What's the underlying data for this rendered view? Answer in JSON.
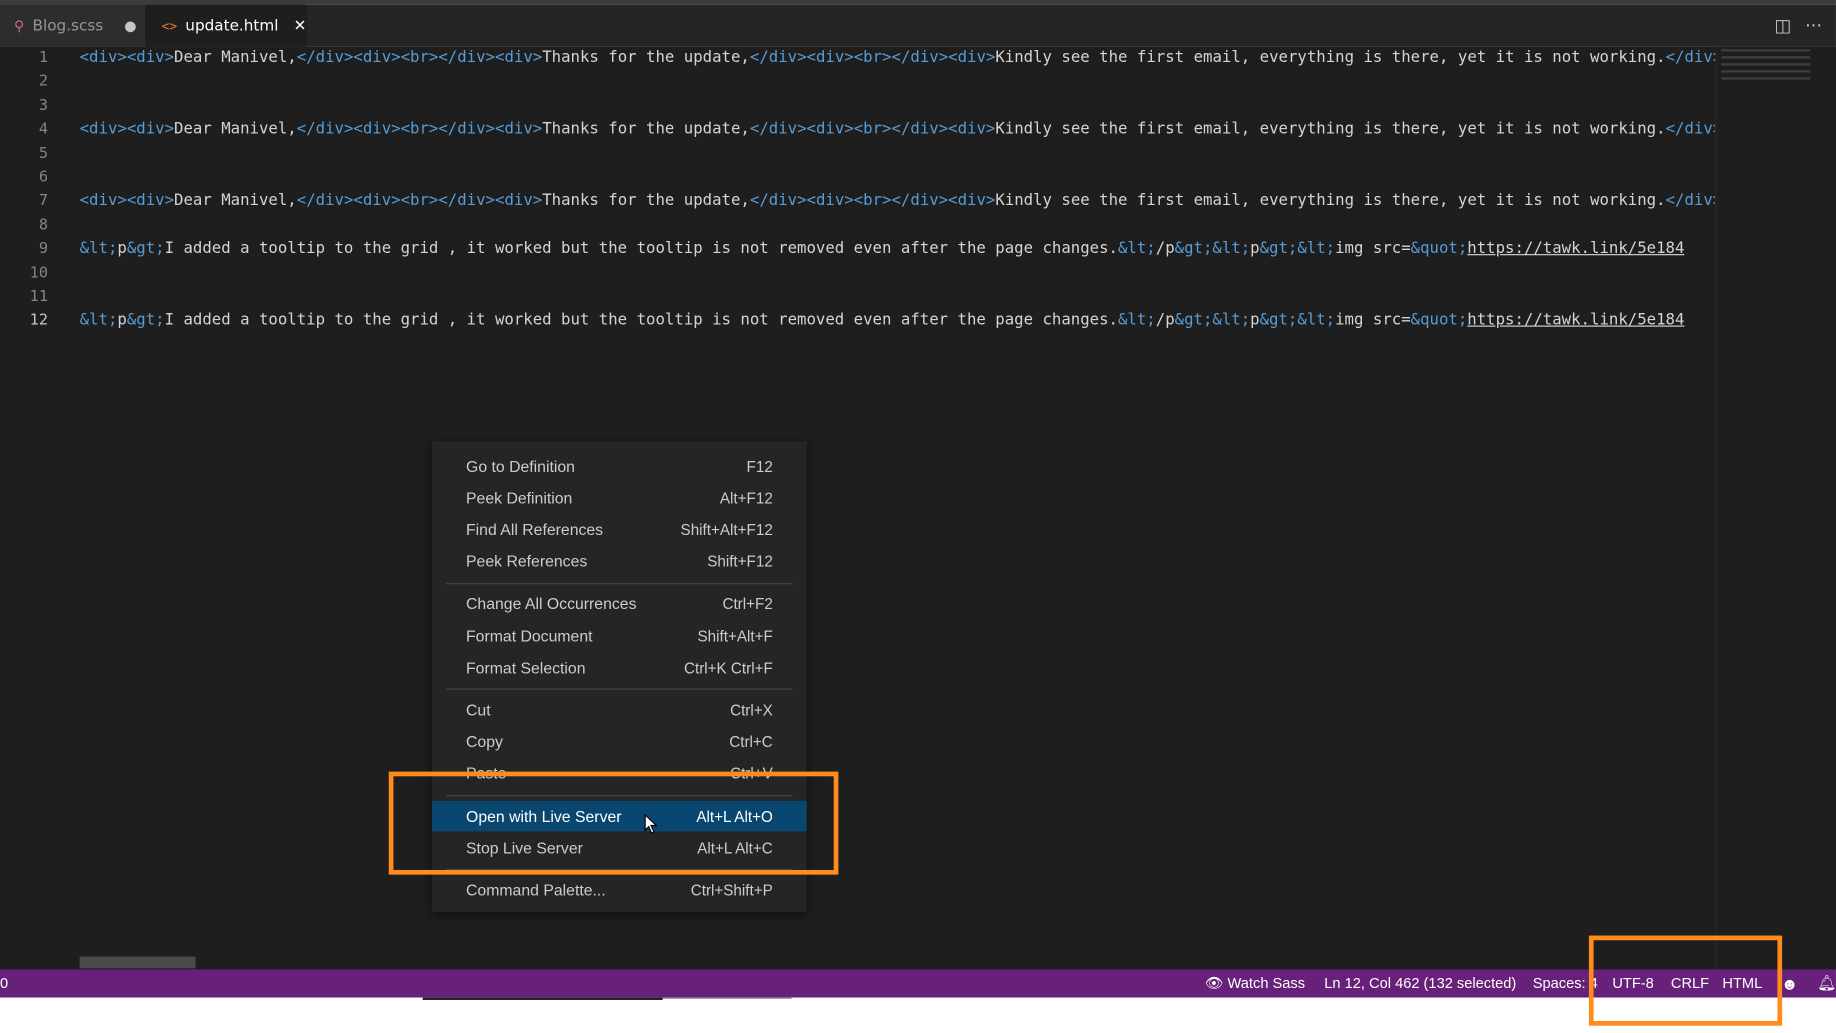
{
  "tabs": [
    {
      "label": "Blog.scss",
      "icon": "sass-file-icon",
      "dirty_symbol": "●"
    },
    {
      "label": "update.html",
      "icon": "html-file-icon",
      "close_symbol": "✕",
      "active": true
    }
  ],
  "tabbar_actions": [
    {
      "icon": "split-editor-icon",
      "glyph": "◫"
    },
    {
      "icon": "more-actions-icon",
      "glyph": "···"
    }
  ],
  "editor": {
    "line_numbers": [
      "1",
      "2",
      "3",
      "4",
      "5",
      "6",
      "7",
      "8",
      "9",
      "10",
      "11",
      "12"
    ],
    "active_line": 12,
    "lines": [
      [
        [
          "t",
          "<div>"
        ],
        [
          "t",
          "<div>"
        ],
        [
          "x",
          "Dear Manivel,"
        ],
        [
          "t",
          "</div>"
        ],
        [
          "t",
          "<div>"
        ],
        [
          "t",
          "<br>"
        ],
        [
          "t",
          "</div>"
        ],
        [
          "t",
          "<div>"
        ],
        [
          "x",
          "Thanks for the update,"
        ],
        [
          "t",
          "</div>"
        ],
        [
          "t",
          "<div>"
        ],
        [
          "t",
          "<br>"
        ],
        [
          "t",
          "</div>"
        ],
        [
          "t",
          "<div>"
        ],
        [
          "x",
          "Kindly see the first email, everything is there, yet it is not working."
        ],
        [
          "t",
          "</div>"
        ]
      ],
      [],
      [],
      [
        [
          "t",
          "<div>"
        ],
        [
          "t",
          "<div>"
        ],
        [
          "x",
          "Dear Manivel,"
        ],
        [
          "t",
          "</div>"
        ],
        [
          "t",
          "<div>"
        ],
        [
          "t",
          "<br>"
        ],
        [
          "t",
          "</div>"
        ],
        [
          "t",
          "<div>"
        ],
        [
          "x",
          "Thanks for the update,"
        ],
        [
          "t",
          "</div>"
        ],
        [
          "t",
          "<div>"
        ],
        [
          "t",
          "<br>"
        ],
        [
          "t",
          "</div>"
        ],
        [
          "t",
          "<div>"
        ],
        [
          "x",
          "Kindly see the first email, everything is there, yet it is not working."
        ],
        [
          "t",
          "</div>"
        ]
      ],
      [],
      [],
      [
        [
          "t",
          "<div>"
        ],
        [
          "t",
          "<div>"
        ],
        [
          "x",
          "Dear Manivel,"
        ],
        [
          "t",
          "</div>"
        ],
        [
          "t",
          "<div>"
        ],
        [
          "t",
          "<br>"
        ],
        [
          "t",
          "</div>"
        ],
        [
          "t",
          "<div>"
        ],
        [
          "x",
          "Thanks for the update,"
        ],
        [
          "t",
          "</div>"
        ],
        [
          "t",
          "<div>"
        ],
        [
          "t",
          "<br>"
        ],
        [
          "t",
          "</div>"
        ],
        [
          "t",
          "<div>"
        ],
        [
          "x",
          "Kindly see the first email, everything is there, yet it is not working."
        ],
        [
          "t",
          "</div>"
        ]
      ],
      [],
      [
        [
          "e",
          "&lt;"
        ],
        [
          "x",
          "p"
        ],
        [
          "e",
          "&gt;"
        ],
        [
          "x",
          "I added a tooltip to the grid , it worked but the tooltip is not removed even after the page changes."
        ],
        [
          "e",
          "&lt;"
        ],
        [
          "x",
          "/p"
        ],
        [
          "e",
          "&gt;"
        ],
        [
          "e",
          "&lt;"
        ],
        [
          "x",
          "p"
        ],
        [
          "e",
          "&gt;"
        ],
        [
          "e",
          "&lt;"
        ],
        [
          "x",
          "img src="
        ],
        [
          "e",
          "&quot;"
        ],
        [
          "u",
          "https://tawk.link/5e184"
        ]
      ],
      [],
      [],
      [
        [
          "e",
          "&lt;"
        ],
        [
          "x",
          "p"
        ],
        [
          "e",
          "&gt;"
        ],
        [
          "x",
          "I added a tooltip to the grid , it worked but the tooltip is not removed even after the page changes."
        ],
        [
          "e",
          "&lt;"
        ],
        [
          "x",
          "/p"
        ],
        [
          "e",
          "&gt;"
        ],
        [
          "e",
          "&lt;"
        ],
        [
          "x",
          "p"
        ],
        [
          "e",
          "&gt;"
        ],
        [
          "e",
          "&lt;"
        ],
        [
          "x",
          "img src="
        ],
        [
          "e",
          "&quot;"
        ],
        [
          "u",
          "https://tawk.link/5e184"
        ]
      ]
    ]
  },
  "context_menu": {
    "groups": [
      [
        {
          "label": "Go to Definition",
          "key": "F12"
        },
        {
          "label": "Peek Definition",
          "key": "Alt+F12"
        },
        {
          "label": "Find All References",
          "key": "Shift+Alt+F12"
        },
        {
          "label": "Peek References",
          "key": "Shift+F12"
        }
      ],
      [
        {
          "label": "Change All Occurrences",
          "key": "Ctrl+F2"
        },
        {
          "label": "Format Document",
          "key": "Shift+Alt+F"
        },
        {
          "label": "Format Selection",
          "key": "Ctrl+K Ctrl+F"
        }
      ],
      [
        {
          "label": "Cut",
          "key": "Ctrl+X"
        },
        {
          "label": "Copy",
          "key": "Ctrl+C"
        },
        {
          "label": "Paste",
          "key": "Ctrl+V"
        }
      ],
      [
        {
          "label": "Open with Live Server",
          "key": "Alt+L Alt+O",
          "highlighted": true
        },
        {
          "label": "Stop Live Server",
          "key": "Alt+L Alt+C"
        }
      ],
      [
        {
          "label": "Command Palette...",
          "key": "Ctrl+Shift+P"
        }
      ]
    ]
  },
  "status_bar": {
    "left": "0",
    "watch_sass": "Watch Sass",
    "position": "Ln 12, Col 462 (132 selected)",
    "spaces": "Spaces: 4",
    "encoding": "UTF-8",
    "eol": "CRLF",
    "language": "HTML",
    "feedback_icon": "smiley-icon",
    "notifications_icon": "bell-icon"
  },
  "colors": {
    "status_bar_bg": "#68217a",
    "menu_highlight": "#094771",
    "annotation_box": "#ff8c1a",
    "tag": "#569cd6",
    "entity": "#569cd6",
    "text": "#d4d4d4"
  }
}
